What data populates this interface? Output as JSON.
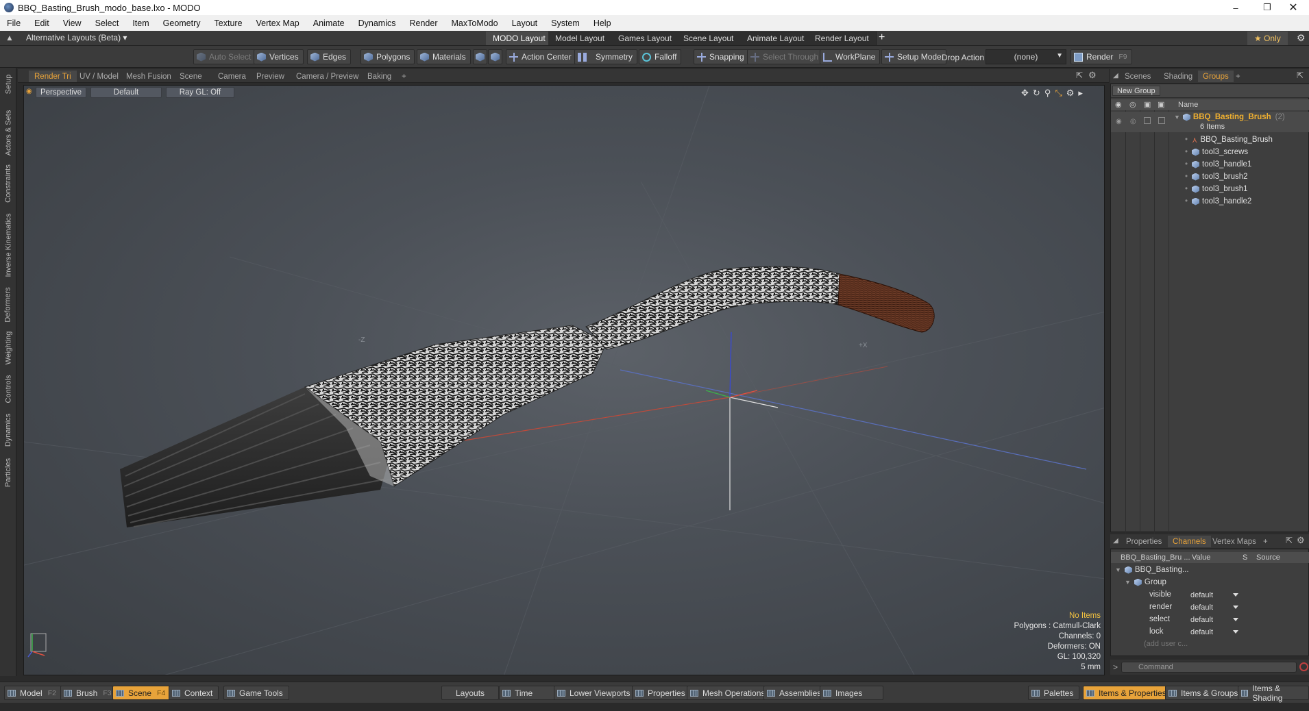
{
  "window": {
    "title": "BBQ_Basting_Brush_modo_base.lxo - MODO"
  },
  "menu": [
    "File",
    "Edit",
    "View",
    "Select",
    "Item",
    "Geometry",
    "Texture",
    "Vertex Map",
    "Animate",
    "Dynamics",
    "Render",
    "MaxToModo",
    "Layout",
    "System",
    "Help"
  ],
  "layout": {
    "selector": "Alternative Layouts (Beta) ▾",
    "tabs": [
      "MODO Layout",
      "Model Layout",
      "Games Layout",
      "Scene Layout",
      "Animate Layout",
      "Render Layout"
    ],
    "active": "MODO Layout",
    "add": "+",
    "only": "★ Only"
  },
  "toolbar": {
    "auto_select": "Auto Select",
    "vertices": "Vertices",
    "edges": "Edges",
    "polygons": "Polygons",
    "materials": "Materials",
    "action_center": "Action Center",
    "symmetry": "Symmetry",
    "falloff": "Falloff",
    "snapping": "Snapping",
    "select_through": "Select Through",
    "workplane": "WorkPlane",
    "setup_mode": "Setup Mode",
    "drop_action": "Drop Action",
    "drop_value": "(none)",
    "render": "Render",
    "render_key": "F9"
  },
  "left_tabs": [
    "Setup",
    "Actors & Sets",
    "Constraints",
    "Inverse Kinematics",
    "Deformers",
    "Weighting",
    "Controls",
    "Dynamics",
    "Particles"
  ],
  "viewport_tabs": [
    "Render Tri",
    "UV / Model",
    "Mesh Fusion",
    "Scene",
    "Camera",
    "Preview",
    "Camera / Preview",
    "Baking",
    "+"
  ],
  "viewport": {
    "view": "Perspective",
    "style": "Default",
    "raygl": "Ray GL: Off",
    "axis_z": "-Z",
    "axis_x": "+X",
    "info": {
      "items": "No Items",
      "polygons": "Polygons : Catmull-Clark",
      "channels": "Channels: 0",
      "deformers": "Deformers: ON",
      "gl": "GL: 100,320",
      "scale": "5 mm"
    }
  },
  "right_tabs": [
    "Scenes",
    "Shading",
    "Groups",
    "+"
  ],
  "groups": {
    "new_group": "New Group",
    "name_header": "Name",
    "root": "BBQ_Basting_Brush",
    "root_count": "(2)",
    "root_sub": "6 Items",
    "children": [
      "BBQ_Basting_Brush",
      "tool3_screws",
      "tool3_handle1",
      "tool3_brush2",
      "tool3_brush1",
      "tool3_handle2"
    ]
  },
  "props_tabs": [
    "Properties",
    "Channels",
    "Vertex Maps",
    "+"
  ],
  "channels": {
    "headers": [
      "BBQ_Basting_Bru ...",
      "Value",
      "S",
      "Source"
    ],
    "item": "BBQ_Basting...",
    "group": "Group",
    "rows": [
      {
        "name": "visible",
        "value": "default"
      },
      {
        "name": "render",
        "value": "default"
      },
      {
        "name": "select",
        "value": "default"
      },
      {
        "name": "lock",
        "value": "default"
      }
    ],
    "add_user": "(add user c..."
  },
  "command": {
    "prompt": ">",
    "placeholder": "Command"
  },
  "bottom": {
    "model": "Model",
    "model_key": "F2",
    "brush": "Brush",
    "brush_key": "F3",
    "scene": "Scene",
    "scene_key": "F4",
    "context": "Context",
    "game_tools": "Game Tools",
    "layouts": "Layouts",
    "time": "Time",
    "lower_viewports": "Lower Viewports",
    "properties": "Properties",
    "mesh_operations": "Mesh Operations",
    "assemblies": "Assemblies",
    "images": "Images",
    "palettes": "Palettes",
    "items_properties": "Items & Properties",
    "items_groups": "Items & Groups",
    "items_shading": "Items & Shading"
  }
}
